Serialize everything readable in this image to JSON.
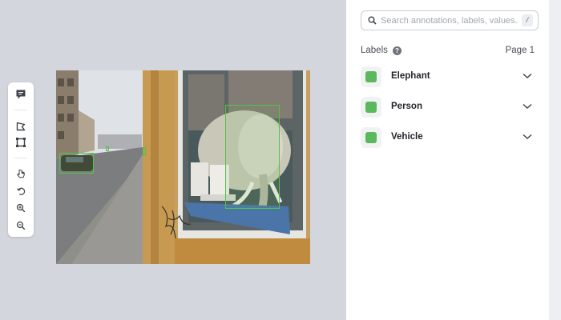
{
  "search": {
    "placeholder": "Search annotations, labels, values...",
    "shortcut": "/"
  },
  "labels_panel": {
    "title": "Labels",
    "page": "Page 1"
  },
  "labels": [
    {
      "name": "Elephant",
      "color": "#5cb85c"
    },
    {
      "name": "Person",
      "color": "#5cb85c"
    },
    {
      "name": "Vehicle",
      "color": "#5cb85c"
    }
  ],
  "annotation_color": "#57c14a",
  "toolbar": [
    "comment-icon",
    "polygon-tool-icon",
    "rectangle-tool-icon",
    "pointer-icon",
    "undo-icon",
    "zoom-in-icon",
    "zoom-out-icon"
  ]
}
